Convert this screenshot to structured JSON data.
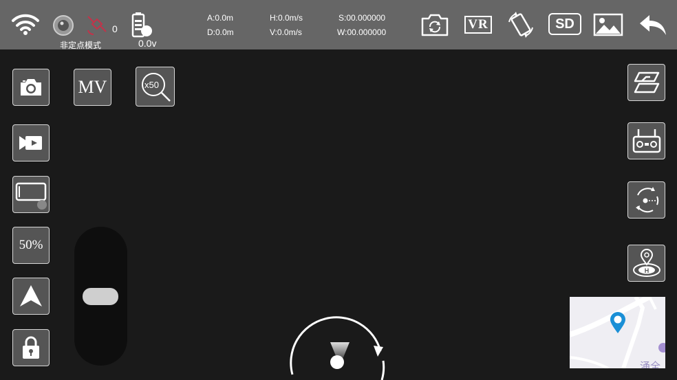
{
  "status_bar": {
    "gps_count": "0",
    "mode_label": "非定点模式",
    "battery_voltage": "0.0v",
    "altitude": "A:0.0m",
    "distance": "D:0.0m",
    "h_speed": "H:0.0m/s",
    "v_speed": "V:0.0m/s",
    "latitude": "S:00.000000",
    "longitude": "W:00.000000",
    "icons": [
      "wifi-icon",
      "camera-signal-icon",
      "gps-icon",
      "battery-icon",
      "switch-camera-icon",
      "vr-icon",
      "rotate-screen-icon",
      "sd-card-icon",
      "gallery-icon",
      "back-icon"
    ],
    "vr_label": "VR",
    "sd_label": "SD"
  },
  "left_panel": {
    "mv_label": "MV",
    "zoom_label": "x50",
    "speed_label": "50%"
  },
  "map": {
    "partial_label": "涌全"
  },
  "colors": {
    "topbar": "#666666",
    "background": "#1a1a1a",
    "button": "#555555",
    "map_pin": "#1a8fd6"
  }
}
